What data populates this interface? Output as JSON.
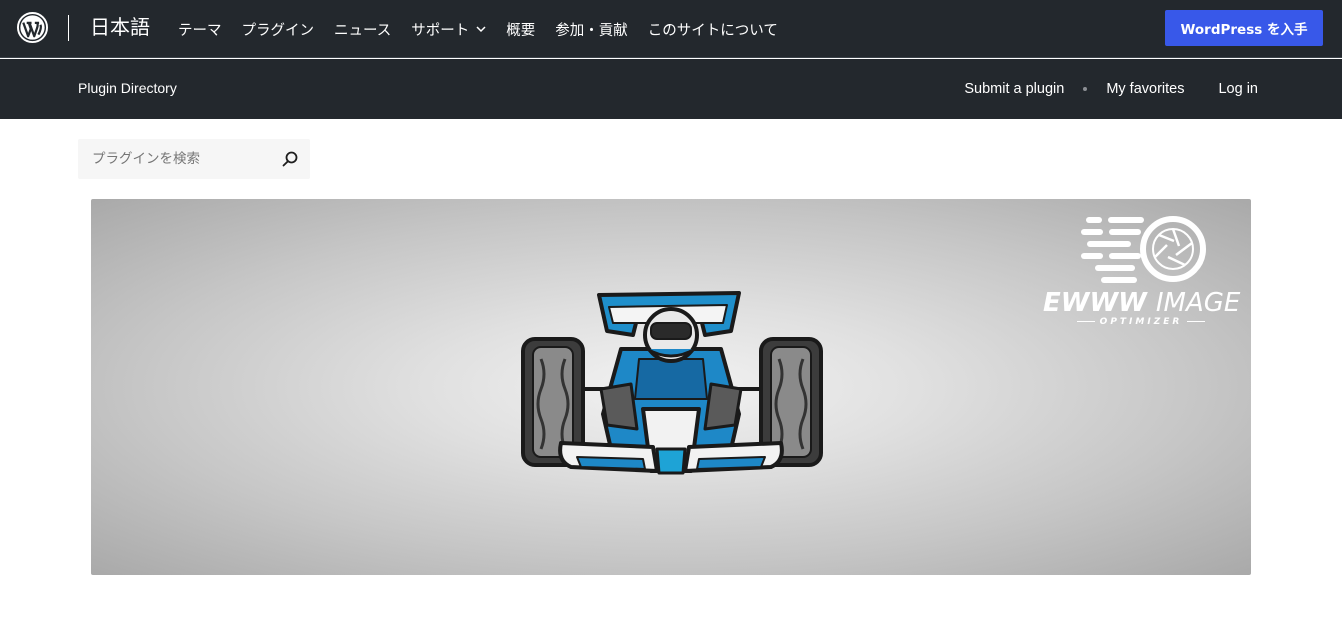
{
  "global_header": {
    "locale": "日本語",
    "nav": [
      {
        "label": "テーマ"
      },
      {
        "label": "プラグイン"
      },
      {
        "label": "ニュース"
      },
      {
        "label": "サポート",
        "has_dropdown": true
      },
      {
        "label": "概要"
      },
      {
        "label": "参加・貢献"
      },
      {
        "label": "このサイトについて"
      }
    ],
    "cta_label": "WordPress を入手",
    "icons": {
      "logo": "wordpress-logo-icon",
      "dropdown": "chevron-down-icon"
    }
  },
  "local_nav": {
    "title": "Plugin Directory",
    "links": {
      "submit": "Submit a plugin",
      "favorites": "My favorites",
      "login": "Log in"
    }
  },
  "search": {
    "placeholder": "プラグインを検索",
    "value": "",
    "icon": "search-icon"
  },
  "banner": {
    "brand_name": "EWWW",
    "brand_name_2": "IMAGE",
    "brand_tagline": "OPTIMIZER",
    "image": "race-car-illustration"
  },
  "colors": {
    "header_bg": "#23282d",
    "cta_bg": "#3858e9",
    "search_bg": "#f6f6f6",
    "car_blue": "#1e88c7"
  }
}
